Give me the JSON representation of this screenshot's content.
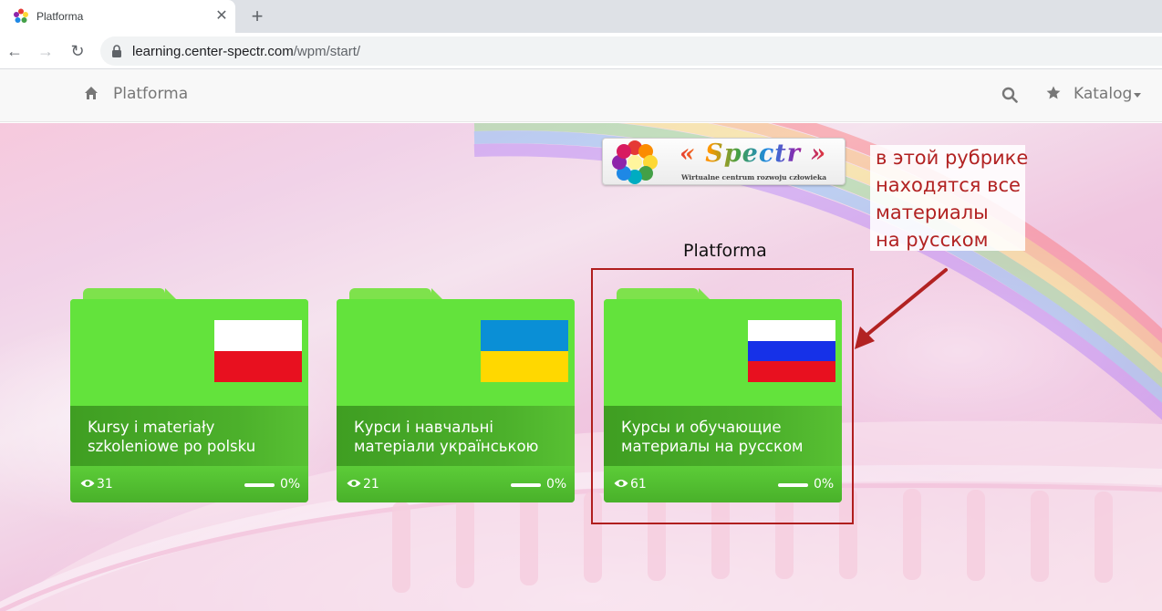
{
  "browser": {
    "tab_title": "Platforma",
    "url_host": "learning.center-spectr.com",
    "url_path": "/wpm/start/"
  },
  "navbar": {
    "brand": "Platforma",
    "katalog": "Katalog"
  },
  "logo": {
    "text": "« Spectr »",
    "subtitle": "Wirtualne centrum rozwoju człowieka"
  },
  "annotation": {
    "lines": [
      "в этой рубрике",
      "находятся все",
      "материалы",
      "на русском"
    ],
    "color": "#b22222"
  },
  "page_title": "Platforma",
  "cards": [
    {
      "title": "Kursy i materiały szkoleniowe po polsku",
      "views": "31",
      "progress": 0,
      "percent": "0%",
      "flag": [
        "#ffffff",
        "#e8101f"
      ]
    },
    {
      "title": "Курси і навчальні матеріали українською",
      "views": "21",
      "progress": 0,
      "percent": "0%",
      "flag": [
        "#0a8fd6",
        "#ffd800"
      ]
    },
    {
      "title": "Курсы и обучающие материалы на русском",
      "views": "61",
      "progress": 0,
      "percent": "0%",
      "flag": [
        "#ffffff",
        "#1631e8",
        "#e8101f"
      ]
    }
  ],
  "colors": {
    "card_green": "#63e33c",
    "card_band": "#4cb02b",
    "highlight": "#b01e1e"
  }
}
